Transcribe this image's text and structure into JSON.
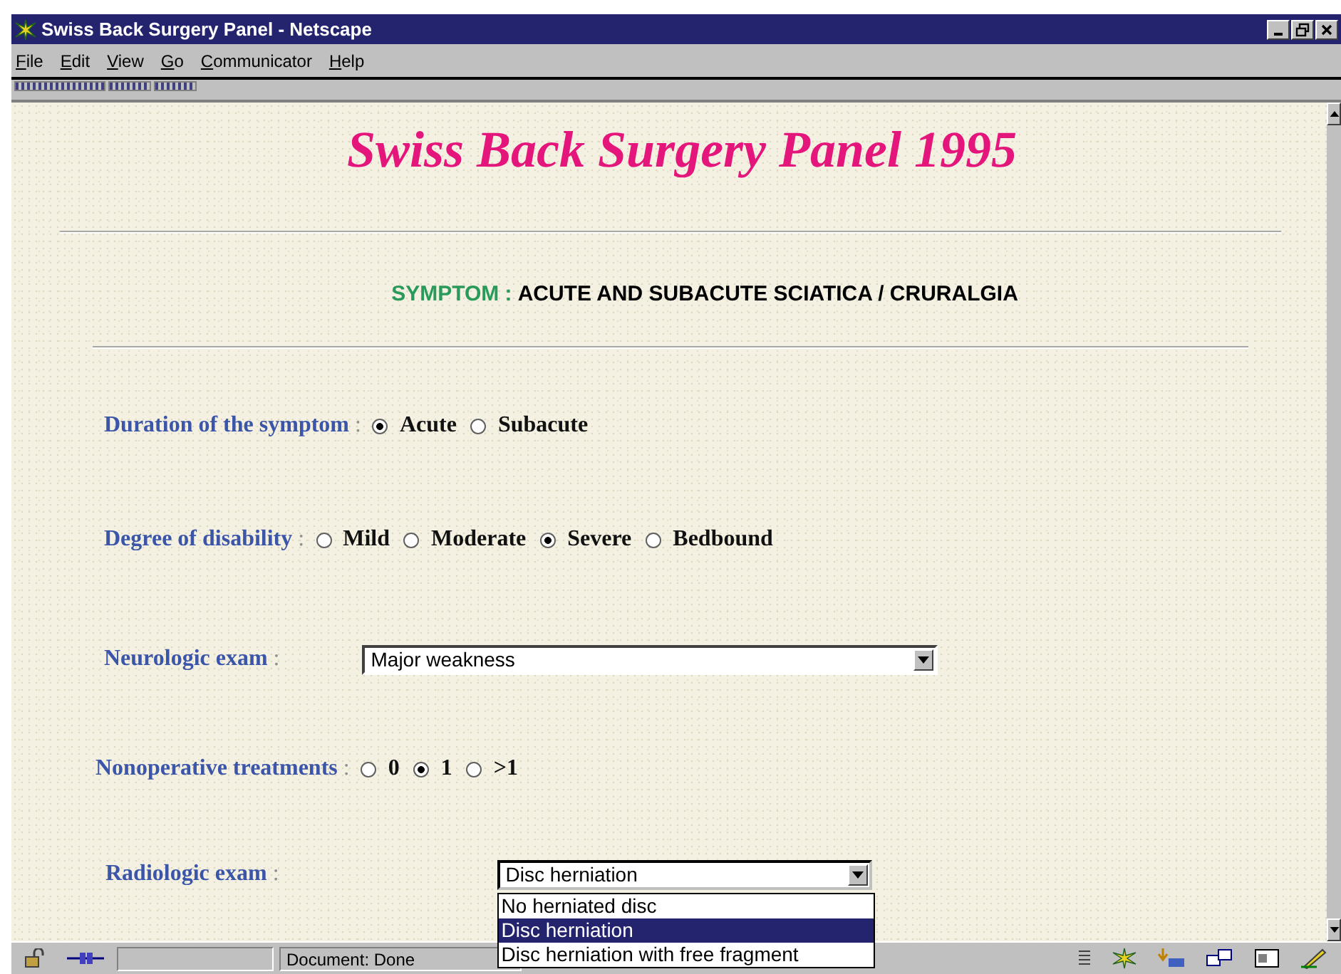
{
  "window": {
    "title": "Swiss Back Surgery Panel - Netscape"
  },
  "menu": [
    "File",
    "Edit",
    "View",
    "Go",
    "Communicator",
    "Help"
  ],
  "page": {
    "heading": "Swiss Back Surgery Panel 1995",
    "symptom_label": "SYMPTOM :",
    "symptom_value": "ACUTE AND SUBACUTE SCIATICA / CRURALGIA"
  },
  "fields": [
    {
      "kind": "radio",
      "label": "Duration of the symptom",
      "separator": ":",
      "options": [
        {
          "label": "Acute",
          "selected": true
        },
        {
          "label": "Subacute",
          "selected": false
        }
      ]
    },
    {
      "kind": "radio",
      "label": "Degree of disability",
      "separator": ":",
      "options": [
        {
          "label": "Mild",
          "selected": false
        },
        {
          "label": "Moderate",
          "selected": false
        },
        {
          "label": "Severe",
          "selected": true
        },
        {
          "label": "Bedbound",
          "selected": false
        }
      ]
    },
    {
      "kind": "select",
      "label": "Neurologic exam",
      "separator": ":",
      "value": "Major weakness",
      "expanded": false
    },
    {
      "kind": "radio",
      "label": "Nonoperative treatments",
      "separator": ":",
      "options": [
        {
          "label": "0",
          "selected": false
        },
        {
          "label": "1",
          "selected": true
        },
        {
          "label": ">1",
          "selected": false
        }
      ]
    },
    {
      "kind": "select",
      "label": "Radiologic exam",
      "separator": ":",
      "value": "Disc herniation",
      "expanded": true,
      "options": [
        {
          "label": "No herniated disc",
          "selected": false
        },
        {
          "label": "Disc herniation",
          "selected": true
        },
        {
          "label": "Disc herniation with free fragment",
          "selected": false
        }
      ]
    }
  ],
  "status_bar": {
    "text": "Document: Done"
  }
}
